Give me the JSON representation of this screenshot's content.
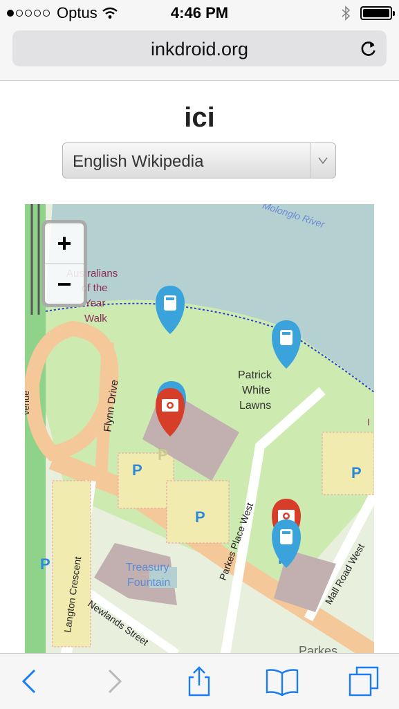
{
  "status_bar": {
    "carrier": "Optus",
    "time": "4:46 PM",
    "signal_bars": 1,
    "icons": [
      "wifi-icon",
      "bluetooth-icon",
      "battery-icon"
    ]
  },
  "browser": {
    "url": "inkdroid.org",
    "reload_icon": "reload-icon"
  },
  "page": {
    "title": "ici",
    "wiki_select": {
      "selected": "English Wikipedia"
    }
  },
  "map": {
    "zoom_in": "+",
    "zoom_out": "−",
    "labels": {
      "river": "Molonglo River",
      "walk1": "Australians",
      "walk2": "of the",
      "walk3": "Year",
      "walk4": "Walk",
      "lawns1": "Patrick",
      "lawns2": "White",
      "lawns3": "Lawns",
      "flynn": "Flynn Drive",
      "parkes_place": "Parkes Place West",
      "mall_road": "Mall Road West",
      "langton": "Langton Crescent",
      "newlands": "Newlands Street",
      "fountain1": "Treasury",
      "fountain2": "Fountain",
      "parkes": "Parkes",
      "parking": "P",
      "edge_left": "venue",
      "edge_right": "I"
    },
    "markers": [
      {
        "kind": "wikipedia",
        "icon": "book-icon",
        "color": "#3aa3dc"
      },
      {
        "kind": "wikipedia",
        "icon": "book-icon",
        "color": "#3aa3dc"
      },
      {
        "kind": "wikipedia",
        "icon": "book-icon",
        "color": "#3aa3dc"
      },
      {
        "kind": "wikipedia",
        "icon": "book-icon",
        "color": "#3aa3dc"
      },
      {
        "kind": "photo",
        "icon": "camera-icon",
        "color": "#d63e2a"
      },
      {
        "kind": "photo",
        "icon": "camera-icon",
        "color": "#d63e2a"
      }
    ]
  },
  "toolbar": {
    "items": [
      "back-icon",
      "forward-icon",
      "share-icon",
      "bookmarks-icon",
      "tabs-icon"
    ],
    "accent": "#1a7cf5"
  }
}
